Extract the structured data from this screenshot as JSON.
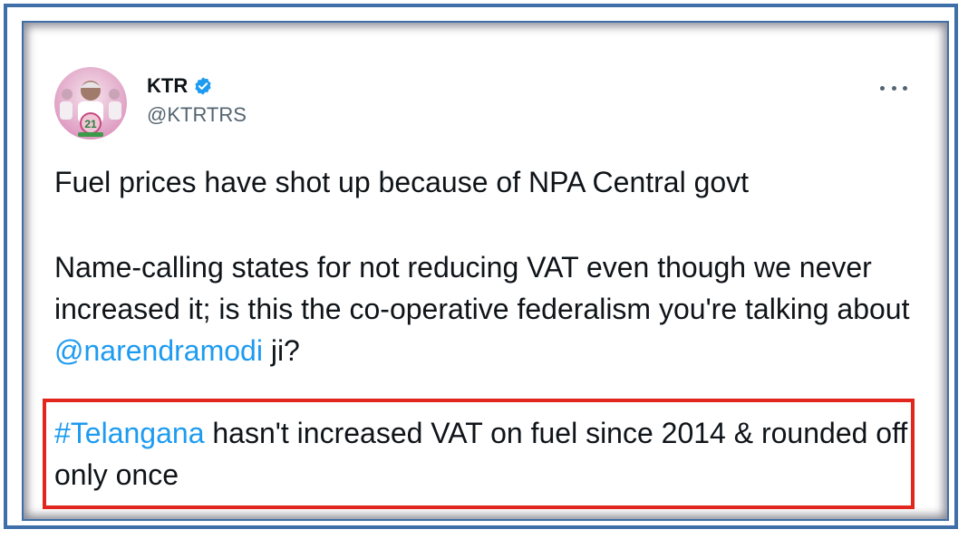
{
  "tweet": {
    "author_name": "KTR",
    "author_handle": "@KTRTRS",
    "paragraph1": "Fuel prices have shot up because of NPA Central govt",
    "paragraph2_before": "Name-calling states for not reducing VAT even though we never increased it; is this the co-operative federalism you're talking about ",
    "paragraph2_mention": "@narendramodi",
    "paragraph2_after": " ji?",
    "paragraph3_hashtag": "#Telangana",
    "paragraph3_after": " hasn't increased VAT on fuel since 2014 & rounded off only once"
  },
  "icons": {
    "verified": "verified-badge-icon",
    "more": "more-options-icon",
    "avatar": "profile-avatar"
  },
  "colors": {
    "frame_border": "#3f6fa8",
    "highlight_border": "#e3261d",
    "link": "#1d9bf0",
    "text": "#0f1419",
    "secondary_text": "#536471",
    "verified": "#1d9bf0"
  }
}
